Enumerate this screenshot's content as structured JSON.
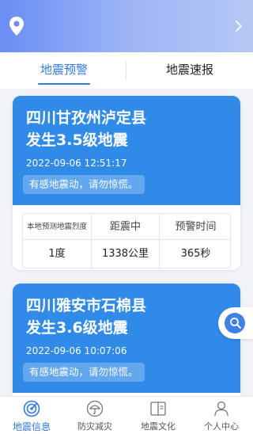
{
  "header": {
    "location_icon": "location-pin-icon",
    "expand_icon": "chevron-right-icon"
  },
  "tabs": [
    {
      "label": "地震预警",
      "active": true
    },
    {
      "label": "地震速报",
      "active": false
    }
  ],
  "stats_headers": [
    "本地预测地震烈度",
    "距震中",
    "预警时间"
  ],
  "cards": [
    {
      "title_line1": "四川甘孜州泸定县",
      "title_line2": "发生3.5级地震",
      "time": "2022-09-06 12:51:17",
      "tip": "有感地震动，请勿惊慌。",
      "stats": [
        "1度",
        "1338公里",
        "365秒"
      ]
    },
    {
      "title_line1": "四川雅安市石棉县",
      "title_line2": "发生3.6级地震",
      "time": "2022-09-06 10:07:06",
      "tip": "有感地震动，请勿惊慌。"
    }
  ],
  "bottom_nav": [
    {
      "label": "地震信息",
      "icon": "radar-icon",
      "active": true
    },
    {
      "label": "防灾减灾",
      "icon": "umbrella-icon",
      "active": false
    },
    {
      "label": "地震文化",
      "icon": "book-icon",
      "active": false
    },
    {
      "label": "个人中心",
      "icon": "person-icon",
      "active": false
    }
  ],
  "colors": {
    "primary": "#2f78e6",
    "card_blue": "#2f8ae8"
  }
}
